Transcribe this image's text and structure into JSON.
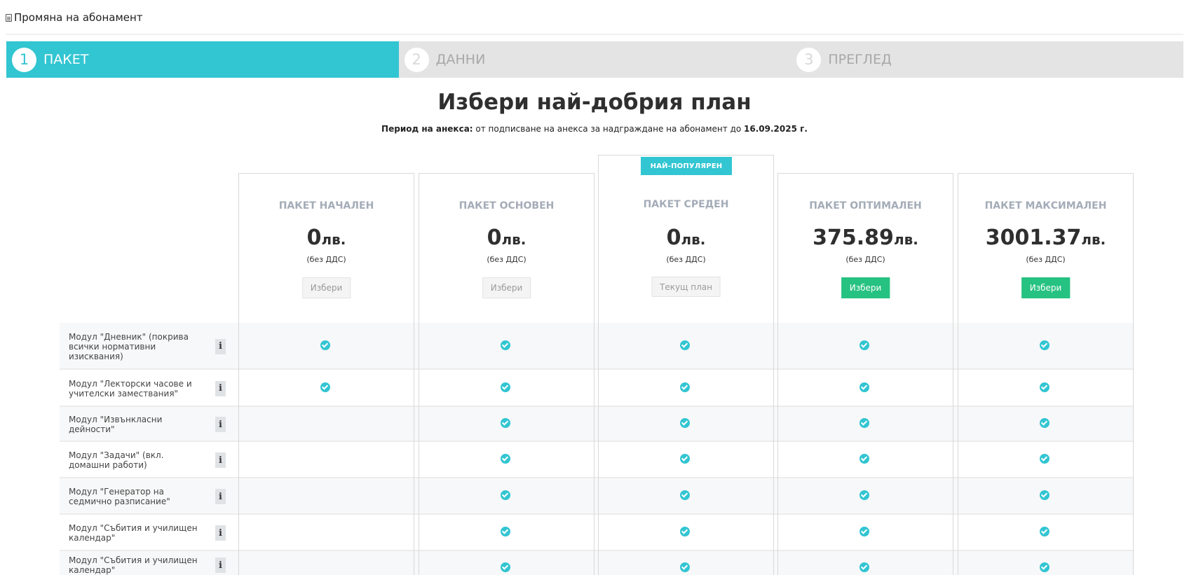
{
  "header": {
    "title": "Промяна на абонамент",
    "icon": "document-icon"
  },
  "wizard": {
    "steps": [
      {
        "num": "1",
        "label": "ПАКЕТ",
        "active": true
      },
      {
        "num": "2",
        "label": "ДАННИ",
        "active": false
      },
      {
        "num": "3",
        "label": "ПРЕГЛЕД",
        "active": false
      }
    ]
  },
  "main": {
    "title": "Избери най-добрия план",
    "period": {
      "label": "Период на анекса:",
      "text": " от подписване на анекса за надграждане на абонамент до ",
      "date": "16.09.2025 г."
    }
  },
  "plans": [
    {
      "name": "ПАКЕТ НАЧАЛЕН",
      "price": "0",
      "currency": "лв.",
      "vat": "(без ДДС)",
      "button": "Избери",
      "button_style": "disabled"
    },
    {
      "name": "ПАКЕТ ОСНОВЕН",
      "price": "0",
      "currency": "лв.",
      "vat": "(без ДДС)",
      "button": "Избери",
      "button_style": "disabled"
    },
    {
      "name": "ПАКЕТ СРЕДЕН",
      "price": "0",
      "currency": "лв.",
      "vat": "(без ДДС)",
      "button": "Текущ план",
      "button_style": "current",
      "badge": "НАЙ-ПОПУЛЯРЕН"
    },
    {
      "name": "ПАКЕТ ОПТИМАЛЕН",
      "price": "375.89",
      "currency": "лв.",
      "vat": "(без ДДС)",
      "button": "Избери",
      "button_style": "primary"
    },
    {
      "name": "ПАКЕТ МАКСИМАЛЕН",
      "price": "3001.37",
      "currency": "лв.",
      "vat": "(без ДДС)",
      "button": "Избери",
      "button_style": "primary"
    }
  ],
  "features": [
    {
      "label": "Модул \"Дневник\" (покрива всички нормативни изисквания)",
      "included": [
        true,
        true,
        true,
        true,
        true
      ]
    },
    {
      "label": "Модул \"Лекторски часове и учителски замествания\"",
      "included": [
        true,
        true,
        true,
        true,
        true
      ]
    },
    {
      "label": "Модул \"Извънкласни дейности\"",
      "included": [
        false,
        true,
        true,
        true,
        true
      ]
    },
    {
      "label": "Модул \"Задачи\" (вкл. домашни работи)",
      "included": [
        false,
        true,
        true,
        true,
        true
      ]
    },
    {
      "label": "Модул \"Генератор на седмично разписание\"",
      "included": [
        false,
        true,
        true,
        true,
        true
      ]
    },
    {
      "label": "Модул \"Събития и училищен календар\"",
      "included": [
        false,
        true,
        true,
        true,
        true
      ]
    },
    {
      "label": "Модул \"Събития и училищен календар\"",
      "included": [
        false,
        true,
        true,
        true,
        true
      ]
    }
  ],
  "colors": {
    "accent": "#32c5d2",
    "success": "#26c281",
    "muted": "#a4acb8"
  }
}
